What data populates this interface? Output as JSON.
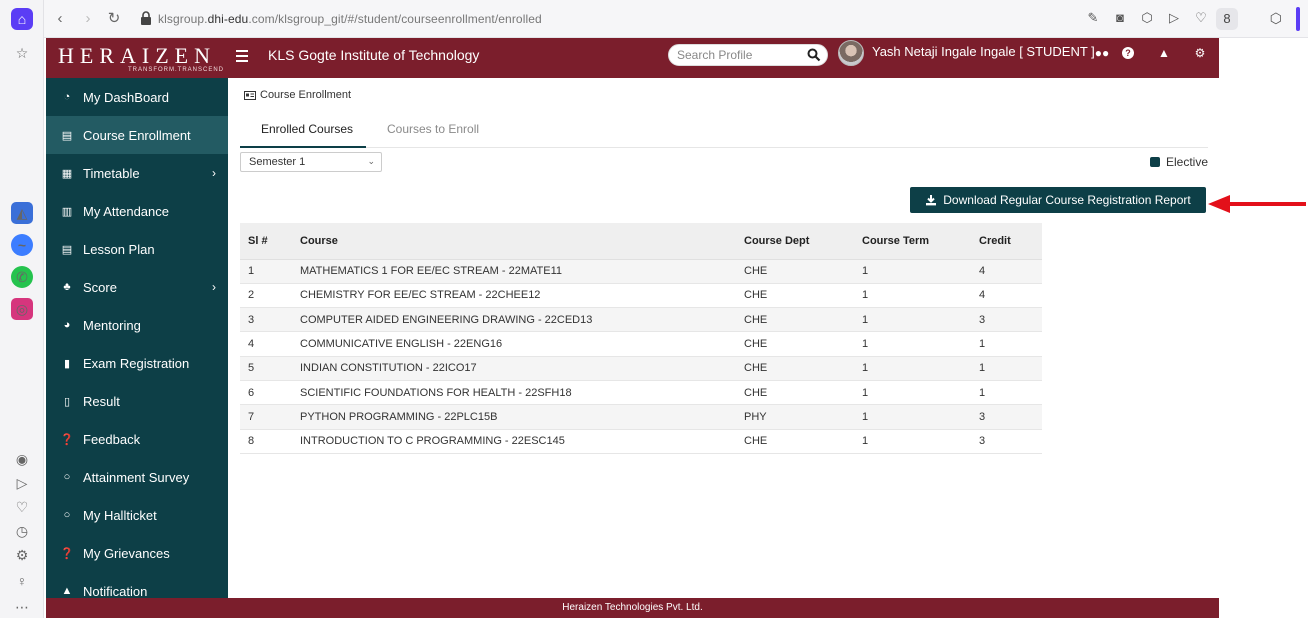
{
  "browser": {
    "url_prefix": "klsgroup.",
    "url_host": "dhi-edu",
    "url_rest": ".com/klsgroup_git/#/student/courseenrollment/enrolled",
    "profile_letter": "8"
  },
  "header": {
    "logo": "HERAIZEN",
    "logo_tagline": "TRANSFORM.TRANSCEND",
    "institute": "KLS Gogte Institute of Technology",
    "search_placeholder": "Search Profile",
    "user_name": "Yash Netaji Ingale Ingale [ STUDENT ]"
  },
  "sidebar": {
    "items": [
      {
        "label": "My DashBoard",
        "icon": "dashboard-icon"
      },
      {
        "label": "Course Enrollment",
        "icon": "id-card-icon",
        "active": true
      },
      {
        "label": "Timetable",
        "icon": "calendar-icon",
        "chevron": true
      },
      {
        "label": "My Attendance",
        "icon": "bar-chart-icon"
      },
      {
        "label": "Lesson Plan",
        "icon": "id-card-icon"
      },
      {
        "label": "Score",
        "icon": "sitemap-icon",
        "chevron": true
      },
      {
        "label": "Mentoring",
        "icon": "user-circle-icon"
      },
      {
        "label": "Exam Registration",
        "icon": "book-icon"
      },
      {
        "label": "Result",
        "icon": "document-icon"
      },
      {
        "label": "Feedback",
        "icon": "question-circle-icon"
      },
      {
        "label": "Attainment Survey",
        "icon": "circle-icon"
      },
      {
        "label": "My Hallticket",
        "icon": "circle-icon"
      },
      {
        "label": "My Grievances",
        "icon": "question-circle-icon"
      },
      {
        "label": "Notification",
        "icon": "bell-icon"
      }
    ]
  },
  "main": {
    "breadcrumb": "Course Enrollment",
    "tabs": [
      {
        "label": "Enrolled Courses",
        "active": true
      },
      {
        "label": "Courses to Enroll",
        "active": false
      }
    ],
    "semester_value": "Semester 1",
    "legend_label": "Elective",
    "download_label": "Download Regular Course Registration Report",
    "table": {
      "headers": [
        "Sl #",
        "Course",
        "Course Dept",
        "Course Term",
        "Credit"
      ],
      "rows": [
        [
          "1",
          "MATHEMATICS 1 FOR EE/EC STREAM - 22MATE11",
          "CHE",
          "1",
          "4"
        ],
        [
          "2",
          "CHEMISTRY FOR EE/EC STREAM - 22CHEE12",
          "CHE",
          "1",
          "4"
        ],
        [
          "3",
          "COMPUTER AIDED ENGINEERING DRAWING - 22CED13",
          "CHE",
          "1",
          "3"
        ],
        [
          "4",
          "COMMUNICATIVE ENGLISH - 22ENG16",
          "CHE",
          "1",
          "1"
        ],
        [
          "5",
          "INDIAN CONSTITUTION - 22ICO17",
          "CHE",
          "1",
          "1"
        ],
        [
          "6",
          "SCIENTIFIC FOUNDATIONS FOR HEALTH - 22SFH18",
          "CHE",
          "1",
          "1"
        ],
        [
          "7",
          "PYTHON PROGRAMMING - 22PLC15B",
          "PHY",
          "1",
          "3"
        ],
        [
          "8",
          "INTRODUCTION TO C PROGRAMMING - 22ESC145",
          "CHE",
          "1",
          "3"
        ]
      ]
    }
  },
  "footer": {
    "text": "Heraizen Technologies Pvt. Ltd."
  },
  "colors": {
    "brand": "#7b1e2c",
    "sidebar": "#0d3f47",
    "sidebar_active": "#235b63",
    "arrow": "#e3101a"
  }
}
